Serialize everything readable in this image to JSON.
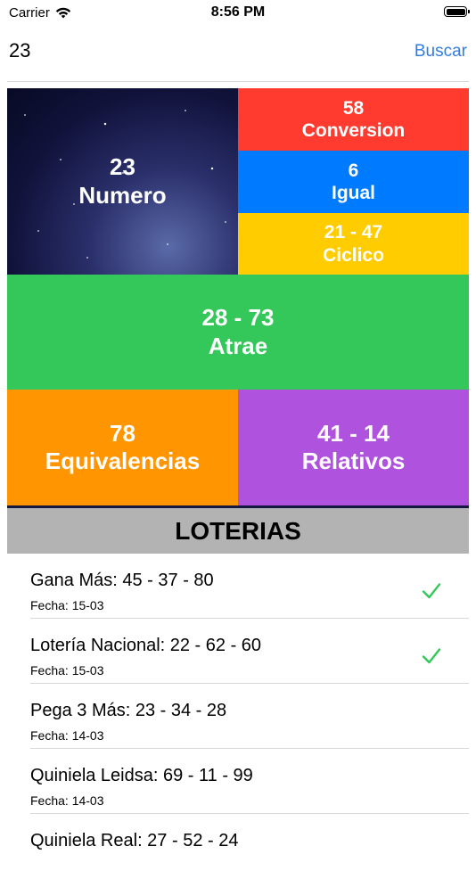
{
  "status": {
    "carrier": "Carrier",
    "time": "8:56 PM"
  },
  "search": {
    "value": "23",
    "button_label": "Buscar"
  },
  "tiles": {
    "numero": {
      "value": "23",
      "label": "Numero"
    },
    "conversion": {
      "value": "58",
      "label": "Conversion",
      "color": "#ff3b30"
    },
    "igual": {
      "value": "6",
      "label": "Igual",
      "color": "#007aff"
    },
    "ciclico": {
      "value": "21 - 47",
      "label": "Ciclico",
      "color": "#ffcc00"
    },
    "atrae": {
      "value": "28 - 73",
      "label": "Atrae",
      "color": "#34c759"
    },
    "equivalencias": {
      "value": "78",
      "label": "Equivalencias",
      "color": "#ff9500"
    },
    "relativos": {
      "value": "41 - 14",
      "label": "Relativos",
      "color": "#af52de"
    }
  },
  "loterias": {
    "header": "LOTERIAS",
    "items": [
      {
        "title": "Gana Más: 45 - 37 - 80",
        "date": "Fecha: 15-03",
        "checked": true,
        "check_icon": "checkmark-icon"
      },
      {
        "title": "Lotería Nacional: 22 - 62 - 60",
        "date": "Fecha: 15-03",
        "checked": true,
        "check_icon": "checkmark-icon"
      },
      {
        "title": "Pega 3 Más: 23 - 34 - 28",
        "date": "Fecha: 14-03",
        "checked": false
      },
      {
        "title": "Quiniela Leidsa: 69 - 11 - 99",
        "date": "Fecha: 14-03",
        "checked": false
      },
      {
        "title": "Quiniela Real: 27 - 52 - 24",
        "date": "",
        "checked": false
      }
    ]
  },
  "colors": {
    "accent": "#2f7de1",
    "check": "#34c759",
    "section_header_bg": "#b3b3b3"
  }
}
